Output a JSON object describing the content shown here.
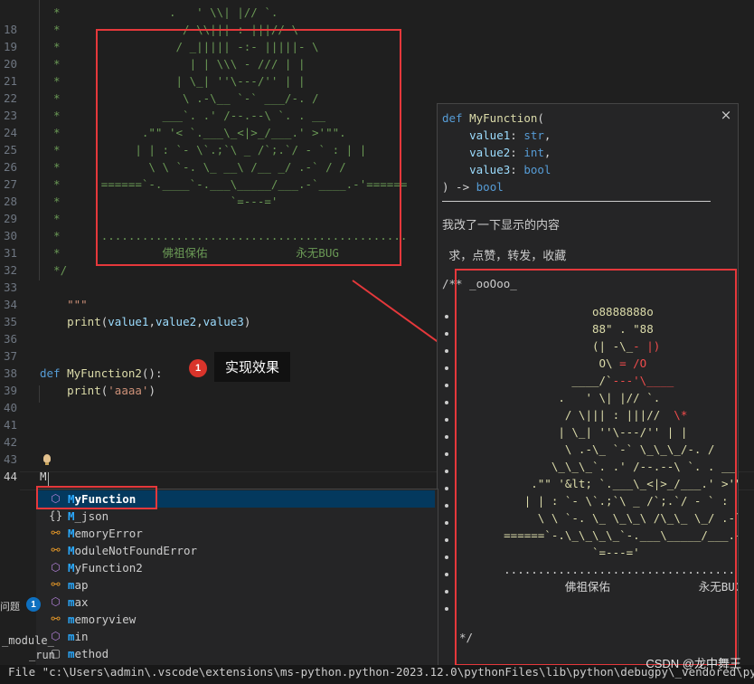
{
  "editor": {
    "lines": [
      {
        "n": "",
        "parts": [
          [
            "cm",
            "  *                .   ' \\\\| |// `."
          ]
        ]
      },
      {
        "n": "18",
        "parts": [
          [
            "cm",
            "  *                  / \\\\||| : |||// \\"
          ]
        ]
      },
      {
        "n": "19",
        "parts": [
          [
            "cm",
            "  *                 / _||||| -:- |||||- \\"
          ]
        ]
      },
      {
        "n": "20",
        "parts": [
          [
            "cm",
            "  *                   | | \\\\\\ - /// | |"
          ]
        ]
      },
      {
        "n": "21",
        "parts": [
          [
            "cm",
            "  *                 | \\_| ''\\---/'' | |"
          ]
        ]
      },
      {
        "n": "22",
        "parts": [
          [
            "cm",
            "  *                  \\ .-\\__ `-` ___/-. /"
          ]
        ]
      },
      {
        "n": "23",
        "parts": [
          [
            "cm",
            "  *               ___`. .' /--.--\\ `. . __"
          ]
        ]
      },
      {
        "n": "24",
        "parts": [
          [
            "cm",
            "  *            .\"\" '< `.___\\_<|>_/___.' >'\"\"."
          ]
        ]
      },
      {
        "n": "25",
        "parts": [
          [
            "cm",
            "  *           | | : `- \\`.;`\\ _ /`;.`/ - ` : | |"
          ]
        ]
      },
      {
        "n": "26",
        "parts": [
          [
            "cm",
            "  *             \\ \\ `-. \\_ __\\ /__ _/ .-` / /"
          ]
        ]
      },
      {
        "n": "27",
        "parts": [
          [
            "cm",
            "  *      ======`-.____`-.___\\_____/___.-`____.-'======"
          ]
        ]
      },
      {
        "n": "28",
        "parts": [
          [
            "cm",
            "  *                         `=---='"
          ]
        ]
      },
      {
        "n": "29",
        "parts": [
          [
            "cm",
            "  *"
          ]
        ]
      },
      {
        "n": "30",
        "parts": [
          [
            "cm",
            "  *      ............................................."
          ]
        ]
      },
      {
        "n": "31",
        "parts": [
          [
            "cm",
            "  *               佛祖保佑             永无BUG"
          ]
        ]
      },
      {
        "n": "32",
        "parts": [
          [
            "cm",
            "  */"
          ]
        ]
      },
      {
        "n": "33",
        "parts": []
      },
      {
        "n": "34",
        "parts": [
          [
            "st",
            "    \"\"\""
          ]
        ]
      },
      {
        "n": "35",
        "parts": [
          [
            "pn",
            "    "
          ],
          [
            "fn",
            "print"
          ],
          [
            "pn",
            "("
          ],
          [
            "vr",
            "value1"
          ],
          [
            "pn",
            ","
          ],
          [
            "vr",
            "value2"
          ],
          [
            "pn",
            ","
          ],
          [
            "vr",
            "value3"
          ],
          [
            "pn",
            ")"
          ]
        ]
      },
      {
        "n": "36",
        "parts": []
      },
      {
        "n": "37",
        "parts": []
      },
      {
        "n": "38",
        "parts": [
          [
            "kw",
            "def "
          ],
          [
            "fn",
            "MyFunction2"
          ],
          [
            "pn",
            "():"
          ]
        ]
      },
      {
        "n": "39",
        "parts": [
          [
            "pn",
            "    "
          ],
          [
            "fn",
            "print"
          ],
          [
            "pn",
            "("
          ],
          [
            "st",
            "'aaaa'"
          ],
          [
            "pn",
            ")"
          ]
        ]
      },
      {
        "n": "40",
        "parts": []
      },
      {
        "n": "41",
        "parts": []
      },
      {
        "n": "42",
        "parts": []
      },
      {
        "n": "43",
        "parts": []
      },
      {
        "n": "44",
        "parts": [
          [
            "pn",
            "M"
          ]
        ]
      }
    ],
    "callout_number": "1",
    "callout_text": "实现效果"
  },
  "hover": {
    "sig_lines": [
      [
        [
          "kw",
          "def "
        ],
        [
          "fn",
          "MyFunction"
        ],
        [
          "pn",
          "("
        ]
      ],
      [
        [
          "pn",
          "    "
        ],
        [
          "vr",
          "value1"
        ],
        [
          "pn",
          ": "
        ],
        [
          "kw",
          "str"
        ],
        [
          "pn",
          ","
        ]
      ],
      [
        [
          "pn",
          "    "
        ],
        [
          "vr",
          "value2"
        ],
        [
          "pn",
          ": "
        ],
        [
          "kw",
          "int"
        ],
        [
          "pn",
          ","
        ]
      ],
      [
        [
          "pn",
          "    "
        ],
        [
          "vr",
          "value3"
        ],
        [
          "pn",
          ": "
        ],
        [
          "kw",
          "bool"
        ]
      ],
      [
        [
          "pn",
          ") -> "
        ],
        [
          "kw",
          "bool"
        ]
      ]
    ],
    "close_glyph": "×",
    "desc1": "我改了一下显示的内容",
    "desc2": "  求，点赞，转发，收藏",
    "doc_start": "/** _ooOoo_",
    "doc_end": "*/",
    "art": [
      [
        [
          "y",
          "                   o8888888o"
        ]
      ],
      [
        [
          "y",
          "                   88\" . \"88"
        ]
      ],
      [
        [
          "y",
          "                   (| -\\_"
        ],
        [
          "r",
          "- |)"
        ]
      ],
      [
        [
          "y",
          "                    O\\ "
        ],
        [
          "r",
          "= /O"
        ]
      ],
      [
        [
          "y",
          "                ____/`"
        ],
        [
          "r",
          "---'\\____"
        ]
      ],
      [
        [
          "y",
          "              .   ' \\| |// `."
        ]
      ],
      [
        [
          "y",
          "               / \\||| : |||//  "
        ],
        [
          "r",
          "\\*"
        ]
      ],
      [
        [
          "y",
          "              | \\_| ''\\---/'' | |"
        ]
      ],
      [
        [
          "y",
          "               \\ .-\\_ `-` \\_\\_\\_/-. /"
        ]
      ],
      [
        [
          "y",
          "             \\_\\_\\_`. .' /--.--\\ `. . __"
        ]
      ],
      [
        [
          "y",
          "          .\"\" '&lt; `.___\\_<|>_/___.' >'\"\"."
        ]
      ],
      [
        [
          "y",
          "         | | : `- \\`.;`\\ _ /`;.`/ - ` : | |"
        ]
      ],
      [
        [
          "y",
          "           \\ \\ `-. \\_ \\_\\_\\ /\\_\\_ \\_/ .-` / /"
        ]
      ],
      [
        [
          "y",
          "      ======`-.\\_\\_\\_\\_`-.___\\_____/___.-`____.-'======"
        ]
      ],
      [
        [
          "y",
          "                   `=---='"
        ]
      ],
      [
        [
          "pn",
          ""
        ]
      ],
      [
        [
          "pn",
          "      ......................................"
        ]
      ],
      [
        [
          "pn",
          "               佛祖保佑             永无BUG"
        ]
      ]
    ]
  },
  "suggest": {
    "items": [
      {
        "icon": "cube",
        "name": "cube-icon",
        "m": "M",
        "rest": "yFunction",
        "selected": true
      },
      {
        "icon": "brace",
        "name": "braces-icon",
        "m": "M",
        "rest": "_json",
        "selected": false
      },
      {
        "icon": "cls",
        "name": "class-icon",
        "m": "M",
        "rest": "emoryError",
        "selected": false
      },
      {
        "icon": "cls",
        "name": "class-icon",
        "m": "M",
        "rest": "oduleNotFoundError",
        "selected": false
      },
      {
        "icon": "cube",
        "name": "cube-icon",
        "m": "M",
        "rest": "yFunction2",
        "selected": false
      },
      {
        "icon": "cls",
        "name": "class-icon",
        "m": "m",
        "rest": "ap",
        "selected": false
      },
      {
        "icon": "cube",
        "name": "cube-icon",
        "m": "m",
        "rest": "ax",
        "selected": false
      },
      {
        "icon": "cls",
        "name": "class-icon",
        "m": "m",
        "rest": "emoryview",
        "selected": false
      },
      {
        "icon": "cube",
        "name": "cube-icon",
        "m": "m",
        "rest": "in",
        "selected": false
      },
      {
        "icon": "kwd",
        "name": "keyword-icon",
        "m": "m",
        "rest": "ethod",
        "selected": false
      }
    ]
  },
  "panel": {
    "problems_label": "问题",
    "problems_count": "1",
    "module_label": "_module_",
    "run_label": "_run"
  },
  "terminal": {
    "line": "File \"c:\\Users\\admin\\.vscode\\extensions\\ms-python.python-2023.12.0\\pythonFiles\\lib\\python\\debugpy\\_vendored\\pydevd\\pydevd_runpy.py\""
  },
  "watermark": "CSDN @龙中舞王"
}
